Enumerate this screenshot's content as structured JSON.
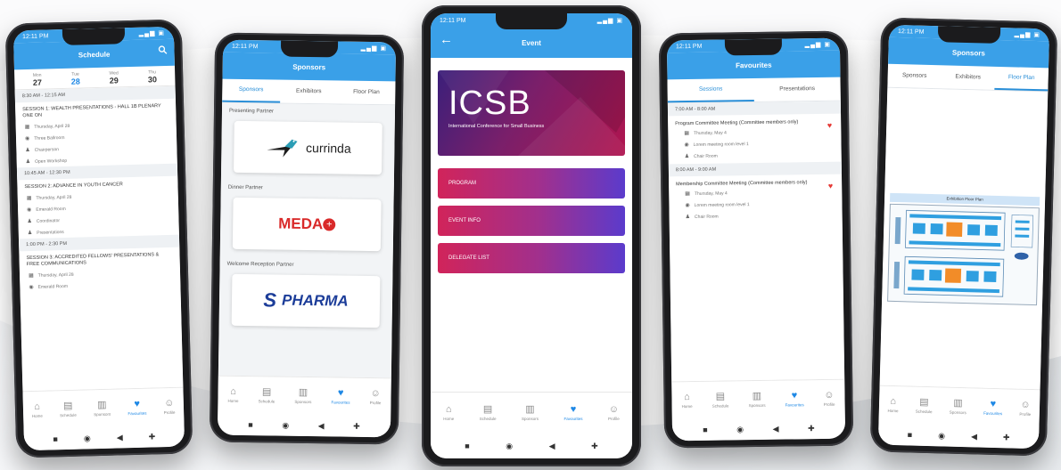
{
  "phone1": {
    "title": "Schedule",
    "dates": [
      {
        "day": "Mon",
        "num": "27"
      },
      {
        "day": "Tue",
        "num": "28"
      },
      {
        "day": "Wed",
        "num": "29"
      },
      {
        "day": "Thu",
        "num": "30"
      }
    ],
    "slots": [
      {
        "time": "8:30 AM - 12:15 AM",
        "title": "SESSION 1: WEALTH PRESENTATIONS - HALL 1B PLENARY ONE ON",
        "rows": [
          "Thursday, April 28",
          "Three Ballroom",
          "Chairperson",
          "Open Workshop"
        ]
      },
      {
        "time": "10:45 AM - 12:30 PM",
        "title": "SESSION 2: ADVANCE IN YOUTH CANCER",
        "rows": [
          "Thursday, April 28",
          "Emerald Room",
          "Coordinator",
          "Presentations"
        ]
      },
      {
        "time": "1:00 PM - 2:30 PM",
        "title": "SESSION 3: ACCREDITED FELLOWS' PRESENTATIONS & FREE COMMUNICATIONS",
        "rows": [
          "Thursday, April 28",
          "Emerald Room"
        ]
      }
    ]
  },
  "phone2": {
    "title": "Sponsors",
    "tabs": [
      "Sponsors",
      "Exhibitors",
      "Floor Plan"
    ],
    "groups": [
      {
        "heading": "Presenting Partner",
        "logo": "currinda"
      },
      {
        "heading": "Dinner Partner",
        "logo": "MEDA"
      },
      {
        "heading": "Welcome Reception Partner",
        "logo": "PHARMA"
      }
    ]
  },
  "phone3": {
    "title": "Event",
    "hero_title": "ICSB",
    "hero_subtitle": "International Conference for Small Business",
    "buttons": [
      "PROGRAM",
      "EVENT INFO",
      "DELEGATE LIST"
    ]
  },
  "phone4": {
    "title": "Favourites",
    "tabs": [
      "Sessions",
      "Presentations"
    ],
    "slots": [
      {
        "time": "7:00 AM - 8:00 AM",
        "title": "Program Committee Meeting (Committee members only)",
        "rows": [
          "Thursday, May 4",
          "Lorem meeting room level 1",
          "Chair Room"
        ]
      },
      {
        "time": "8:00 AM - 9:00 AM",
        "title": "Membership Committee Meeting (Committee members only)",
        "rows": [
          "Thursday, May 4",
          "Lorem meeting room level 1",
          "Chair Room"
        ]
      }
    ]
  },
  "phone5": {
    "title": "Sponsors",
    "tabs": [
      "Sponsors",
      "Exhibitors",
      "Floor Plan"
    ],
    "plan_title": "Exhibition Floor Plan"
  },
  "nav": [
    "Home",
    "Schedule",
    "Sponsors",
    "Favourites",
    "Profile"
  ],
  "status_time": "12:11 PM",
  "colors": {
    "primary": "#3aa0e8",
    "accent": "#1e88e5"
  }
}
